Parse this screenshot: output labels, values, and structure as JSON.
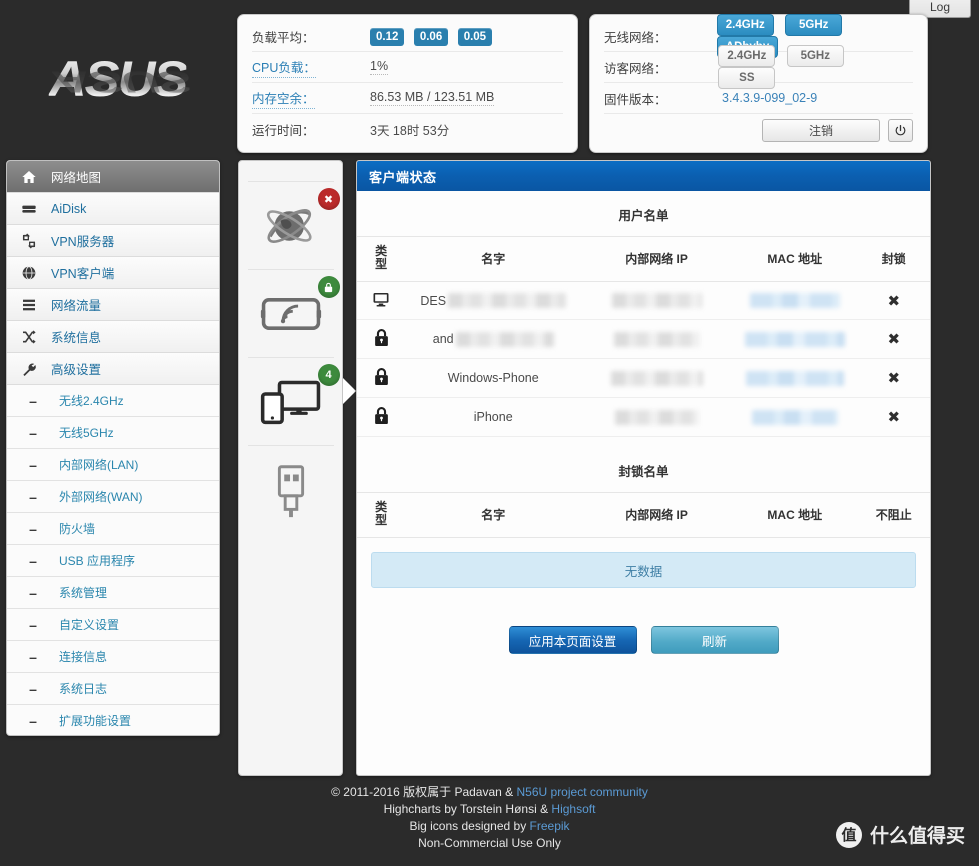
{
  "window": {
    "log_tab": "Log"
  },
  "brand": {
    "logo_text": "ASUS"
  },
  "status_left": {
    "rows": [
      {
        "label": "负载平均：",
        "type": "badges",
        "values": [
          "0.12",
          "0.06",
          "0.05"
        ]
      },
      {
        "label": "CPU负载：",
        "type": "text",
        "value": "1%"
      },
      {
        "label": "内存空余：",
        "type": "text",
        "value": "86.53 MB / 123.51 MB"
      },
      {
        "label": "运行时间：",
        "type": "plain",
        "value": "3天 18时 53分"
      }
    ]
  },
  "status_right": {
    "wireless_label": "无线网络：",
    "wireless": [
      {
        "label": "2.4GHz",
        "state": "on"
      },
      {
        "label": "5GHz",
        "state": "on"
      },
      {
        "label": "ADbyby",
        "state": "on"
      }
    ],
    "guest_label": "访客网络：",
    "guest": [
      {
        "label": "2.4GHz",
        "state": "off"
      },
      {
        "label": "5GHz",
        "state": "off"
      },
      {
        "label": "SS",
        "state": "off"
      }
    ],
    "firmware_label": "固件版本：",
    "firmware_value": "3.4.3.9-099_02-9",
    "logout_label": "注销",
    "power_icon": "power-icon"
  },
  "sidebar": {
    "items": [
      {
        "label": "网络地图",
        "icon": "home-icon",
        "active": true
      },
      {
        "label": "AiDisk",
        "icon": "disk-icon",
        "active": false
      },
      {
        "label": "VPN服务器",
        "icon": "vpn-server-icon",
        "active": false
      },
      {
        "label": "VPN客户端",
        "icon": "globe-icon",
        "active": false
      },
      {
        "label": "网络流量",
        "icon": "traffic-icon",
        "active": false
      },
      {
        "label": "系统信息",
        "icon": "shuffle-icon",
        "active": false
      },
      {
        "label": "高级设置",
        "icon": "wrench-icon",
        "active": false
      }
    ],
    "subitems": [
      {
        "label": "无线2.4GHz"
      },
      {
        "label": "无线5GHz"
      },
      {
        "label": "内部网络(LAN)"
      },
      {
        "label": "外部网络(WAN)"
      },
      {
        "label": "防火墙"
      },
      {
        "label": "USB 应用程序"
      },
      {
        "label": "系统管理"
      },
      {
        "label": "自定义设置"
      },
      {
        "label": "连接信息"
      },
      {
        "label": "系统日志"
      },
      {
        "label": "扩展功能设置"
      }
    ]
  },
  "iconpanel": {
    "slots": [
      {
        "icon": "internet-globe-icon",
        "badge": "✖",
        "badge_color": "red"
      },
      {
        "icon": "wireless-router-icon",
        "badge": "🔒",
        "badge_color": "green"
      },
      {
        "icon": "clients-devices-icon",
        "badge": "4",
        "badge_color": "green"
      },
      {
        "icon": "usb-icon",
        "badge": "",
        "badge_color": ""
      }
    ]
  },
  "main": {
    "panel_title": "客户端状态",
    "clients_section_title": "用户名单",
    "columns": [
      "类\n型",
      "名字",
      "内部网络 IP",
      "MAC 地址",
      "封锁"
    ],
    "col_type_line1": "类",
    "col_type_line2": "型",
    "col_name": "名字",
    "col_ip": "内部网络 IP",
    "col_mac": "MAC 地址",
    "col_block": "封锁",
    "rows": [
      {
        "type_icon": "monitor-icon",
        "name_visible": "DES",
        "name_redacted": true,
        "ip_redacted": true,
        "mac_redacted": true,
        "action": "✖"
      },
      {
        "type_icon": "lock-icon",
        "name_visible": "and",
        "name_redacted": true,
        "ip_redacted": true,
        "mac_redacted": true,
        "action": "✖"
      },
      {
        "type_icon": "lock-icon",
        "name_visible": "Windows-Phone",
        "name_redacted": false,
        "ip_redacted": true,
        "mac_redacted": true,
        "action": "✖"
      },
      {
        "type_icon": "lock-icon",
        "name_visible": "iPhone",
        "name_redacted": false,
        "ip_redacted": true,
        "mac_redacted": true,
        "action": "✖"
      }
    ],
    "blocked_section_title": "封锁名单",
    "blocked_col_type_line1": "类",
    "blocked_col_type_line2": "型",
    "blocked_col_name": "名字",
    "blocked_col_ip": "内部网络 IP",
    "blocked_col_mac": "MAC 地址",
    "blocked_col_unblock": "不阻止",
    "blocked_empty": "无数据",
    "apply_button": "应用本页面设置",
    "refresh_button": "刷新"
  },
  "footer": {
    "line1_a": "© 2011-2016 版权属于 Padavan & ",
    "line1_link": "N56U project community",
    "line2_a": "Highcharts by Torstein Hønsi & ",
    "line2_link": "Highsoft",
    "line3_a": "Big icons designed by ",
    "line3_link": "Freepik",
    "line4": "Non-Commercial Use Only"
  },
  "watermark": {
    "mark": "值",
    "text": "什么值得买"
  },
  "colors": {
    "accent_blue": "#0b5fb0",
    "badge_blue": "#2a7fae",
    "link_blue": "#2a86ad",
    "page_bg": "#2b2b2b",
    "status_green": "#3d8a3d",
    "status_red": "#bb2b2b"
  }
}
